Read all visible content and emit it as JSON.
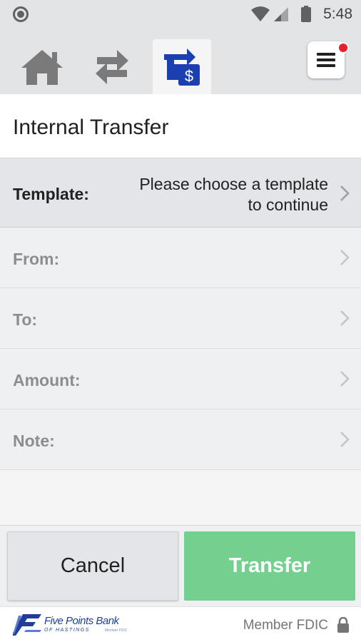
{
  "status_bar": {
    "time": "5:48",
    "icons": [
      "notification-dot-icon",
      "wifi-icon",
      "cellular-signal-icon",
      "battery-icon"
    ]
  },
  "nav": {
    "tabs": [
      {
        "name": "home",
        "icon": "home-icon",
        "active": false
      },
      {
        "name": "transfers",
        "icon": "swap-arrows-icon",
        "active": false
      },
      {
        "name": "internal-transfer",
        "icon": "transfer-dollar-icon",
        "active": true
      }
    ],
    "menu_icon": "hamburger-menu-icon",
    "menu_badge_color": "#e8202e"
  },
  "page": {
    "title": "Internal Transfer"
  },
  "form": {
    "template": {
      "label": "Template:",
      "value_line1": "Please choose a template",
      "value_line2": "to continue"
    },
    "from": {
      "label": "From:"
    },
    "to": {
      "label": "To:"
    },
    "amount": {
      "label": "Amount:"
    },
    "note": {
      "label": "Note:"
    }
  },
  "buttons": {
    "cancel": "Cancel",
    "transfer": "Transfer",
    "transfer_color": "#73d08f"
  },
  "footer": {
    "logo_name": "Five Points Bank",
    "logo_sub": "OF HASTINGS",
    "logo_fdic": "Member FDIC",
    "member_fdic": "Member FDIC"
  },
  "colors": {
    "accent_blue": "#1b3fb0",
    "nav_gray": "#7a7a7a"
  }
}
